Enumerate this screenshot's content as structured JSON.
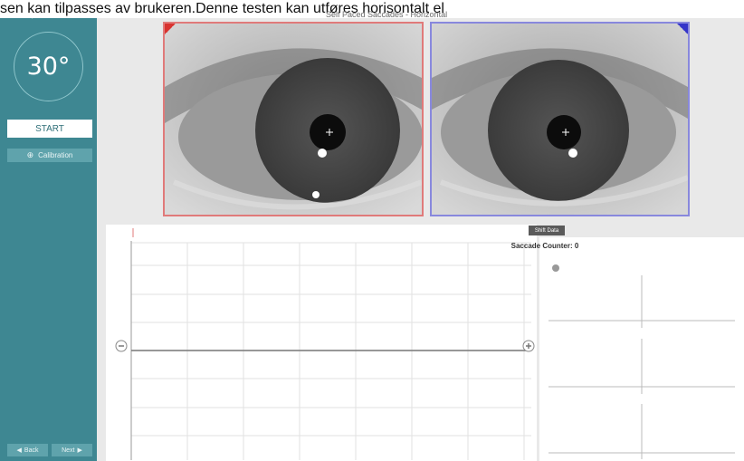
{
  "caption_text": "sen kan tilpasses av brukeren.Denne testen kan utføres horisontalt el",
  "test_title": "Self Paced Saccades - Horizontal",
  "sidebar": {
    "angle": "30°",
    "start_label": "START",
    "calibration_label": "Calibration",
    "back_label": "Back",
    "next_label": "Next"
  },
  "icons": {
    "menu": "menu-icon",
    "home": "home-icon",
    "upload": "upload-icon",
    "gear": "gear-icon",
    "crosshair": "crosshair-icon"
  },
  "colors": {
    "sidebar": "#3e8792",
    "left_eye": "#d8332f",
    "right_eye": "#3535c8"
  },
  "right_panel": {
    "shift_label": "Shift Data",
    "counter_label": "Saccade Counter: 0"
  }
}
